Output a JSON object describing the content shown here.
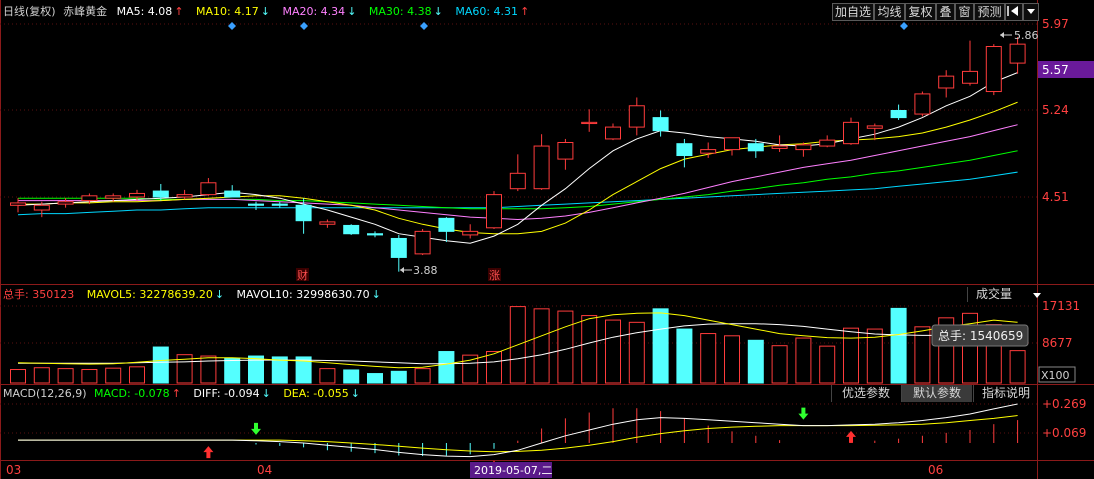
{
  "header": {
    "period": "日线(复权)",
    "stock_name": "赤峰黄金",
    "ma5": "MA5: 4.08",
    "ma10": "MA10: 4.17",
    "ma20": "MA20: 4.34",
    "ma30": "MA30: 4.38",
    "ma60": "MA60: 4.31"
  },
  "toolbar": {
    "add_favorite": "加自选",
    "avg_line": "均线",
    "adjust": "复权",
    "overlay": "叠",
    "window": "窗",
    "forecast": "预测"
  },
  "price_axis": {
    "labels": [
      "5.97",
      "5.57",
      "5.24",
      "4.51"
    ],
    "highlight": "5.57",
    "max_note": "5.86",
    "min_note": "3.88"
  },
  "markers": {
    "cai": "财",
    "zhang": "涨"
  },
  "volume": {
    "total": "总手: 350123",
    "mavol5": "MAVOL5: 32278639.20",
    "mavol10": "MAVOL10: 32998630.70",
    "selector": "成交量",
    "axis_top": "17131",
    "axis_mid": "8677",
    "axis_unit": "X100",
    "tooltip": "总手: 1540659"
  },
  "macd": {
    "title": "MACD(12,26,9)",
    "macd": "MACD: -0.078",
    "diff": "DIFF: -0.094",
    "dea": "DEA: -0.055",
    "btn_optimize": "优选参数",
    "btn_default": "默认参数",
    "btn_explain": "指标说明",
    "axis_top": "+0.269",
    "axis_mid": "+0.069"
  },
  "date_axis": {
    "labels": [
      "03",
      "04",
      "06"
    ],
    "cursor_date": "2019-05-07,二"
  },
  "colors": {
    "up": "#ff3c3c",
    "down": "#54ffff",
    "ma5": "#ffffff",
    "ma10": "#ffff00",
    "ma20": "#ff80ff",
    "ma30": "#00ff00",
    "ma60": "#00d8ff"
  },
  "chart_data": {
    "type": "candlestick",
    "price_ylim": [
      3.88,
      5.97
    ],
    "candles": [
      {
        "o": 4.44,
        "h": 4.5,
        "l": 4.38,
        "c": 4.46
      },
      {
        "o": 4.4,
        "h": 4.47,
        "l": 4.34,
        "c": 4.44
      },
      {
        "o": 4.45,
        "h": 4.5,
        "l": 4.42,
        "c": 4.47
      },
      {
        "o": 4.48,
        "h": 4.54,
        "l": 4.45,
        "c": 4.52
      },
      {
        "o": 4.5,
        "h": 4.54,
        "l": 4.47,
        "c": 4.52
      },
      {
        "o": 4.51,
        "h": 4.57,
        "l": 4.48,
        "c": 4.54
      },
      {
        "o": 4.56,
        "h": 4.62,
        "l": 4.48,
        "c": 4.51
      },
      {
        "o": 4.51,
        "h": 4.57,
        "l": 4.49,
        "c": 4.53
      },
      {
        "o": 4.53,
        "h": 4.67,
        "l": 4.52,
        "c": 4.63
      },
      {
        "o": 4.56,
        "h": 4.61,
        "l": 4.51,
        "c": 4.51
      },
      {
        "o": 4.45,
        "h": 4.47,
        "l": 4.4,
        "c": 4.44
      },
      {
        "o": 4.45,
        "h": 4.47,
        "l": 4.42,
        "c": 4.44
      },
      {
        "o": 4.44,
        "h": 4.5,
        "l": 4.2,
        "c": 4.31
      },
      {
        "o": 4.28,
        "h": 4.32,
        "l": 4.25,
        "c": 4.3
      },
      {
        "o": 4.27,
        "h": 4.28,
        "l": 4.19,
        "c": 4.2
      },
      {
        "o": 4.2,
        "h": 4.22,
        "l": 4.17,
        "c": 4.19
      },
      {
        "o": 4.16,
        "h": 4.19,
        "l": 3.88,
        "c": 4.0
      },
      {
        "o": 4.03,
        "h": 4.24,
        "l": 4.02,
        "c": 4.22
      },
      {
        "o": 4.33,
        "h": 4.34,
        "l": 4.13,
        "c": 4.22
      },
      {
        "o": 4.19,
        "h": 4.28,
        "l": 4.16,
        "c": 4.22
      },
      {
        "o": 4.25,
        "h": 4.56,
        "l": 4.24,
        "c": 4.53
      },
      {
        "o": 4.58,
        "h": 4.87,
        "l": 4.56,
        "c": 4.71
      },
      {
        "o": 4.58,
        "h": 5.04,
        "l": 4.57,
        "c": 4.94
      },
      {
        "o": 4.83,
        "h": 5.0,
        "l": 4.74,
        "c": 4.97
      },
      {
        "o": 5.13,
        "h": 5.25,
        "l": 5.06,
        "c": 5.14
      },
      {
        "o": 5.0,
        "h": 5.13,
        "l": 4.99,
        "c": 5.1
      },
      {
        "o": 5.1,
        "h": 5.35,
        "l": 5.03,
        "c": 5.28
      },
      {
        "o": 5.18,
        "h": 5.24,
        "l": 5.02,
        "c": 5.07
      },
      {
        "o": 4.96,
        "h": 5.0,
        "l": 4.76,
        "c": 4.86
      },
      {
        "o": 4.88,
        "h": 4.97,
        "l": 4.84,
        "c": 4.91
      },
      {
        "o": 4.91,
        "h": 5.01,
        "l": 4.86,
        "c": 5.01
      },
      {
        "o": 4.96,
        "h": 5.0,
        "l": 4.84,
        "c": 4.9
      },
      {
        "o": 4.92,
        "h": 5.03,
        "l": 4.89,
        "c": 4.94
      },
      {
        "o": 4.91,
        "h": 4.97,
        "l": 4.85,
        "c": 4.95
      },
      {
        "o": 4.94,
        "h": 5.03,
        "l": 4.93,
        "c": 4.99
      },
      {
        "o": 4.96,
        "h": 5.18,
        "l": 4.95,
        "c": 5.14
      },
      {
        "o": 5.09,
        "h": 5.13,
        "l": 4.99,
        "c": 5.11
      },
      {
        "o": 5.24,
        "h": 5.29,
        "l": 5.16,
        "c": 5.18
      },
      {
        "o": 5.21,
        "h": 5.4,
        "l": 5.19,
        "c": 5.38
      },
      {
        "o": 5.43,
        "h": 5.58,
        "l": 5.35,
        "c": 5.53
      },
      {
        "o": 5.47,
        "h": 5.83,
        "l": 5.45,
        "c": 5.57
      },
      {
        "o": 5.4,
        "h": 5.8,
        "l": 5.37,
        "c": 5.78
      },
      {
        "o": 5.64,
        "h": 5.86,
        "l": 5.55,
        "c": 5.8
      }
    ],
    "ma5": [
      4.44,
      4.45,
      4.46,
      4.47,
      4.48,
      4.49,
      4.5,
      4.51,
      4.53,
      4.55,
      4.53,
      4.5,
      4.45,
      4.4,
      4.34,
      4.28,
      4.2,
      4.17,
      4.14,
      4.12,
      4.18,
      4.28,
      4.44,
      4.58,
      4.75,
      4.9,
      5.0,
      5.07,
      5.05,
      5.02,
      5.0,
      4.98,
      4.95,
      4.94,
      4.96,
      5.0,
      5.04,
      5.1,
      5.18,
      5.28,
      5.36,
      5.48,
      5.56
    ],
    "ma10": [
      4.45,
      4.45,
      4.46,
      4.46,
      4.47,
      4.47,
      4.48,
      4.49,
      4.5,
      4.51,
      4.52,
      4.52,
      4.5,
      4.47,
      4.44,
      4.4,
      4.33,
      4.28,
      4.24,
      4.21,
      4.2,
      4.2,
      4.22,
      4.29,
      4.4,
      4.53,
      4.64,
      4.75,
      4.83,
      4.87,
      4.91,
      4.93,
      4.95,
      4.96,
      4.98,
      4.99,
      5.0,
      5.02,
      5.05,
      5.1,
      5.16,
      5.23,
      5.31
    ],
    "ma20": [
      4.48,
      4.48,
      4.48,
      4.48,
      4.48,
      4.48,
      4.48,
      4.49,
      4.49,
      4.49,
      4.48,
      4.47,
      4.46,
      4.45,
      4.44,
      4.42,
      4.4,
      4.38,
      4.36,
      4.34,
      4.33,
      4.32,
      4.33,
      4.35,
      4.38,
      4.42,
      4.46,
      4.5,
      4.54,
      4.59,
      4.64,
      4.68,
      4.72,
      4.76,
      4.79,
      4.82,
      4.86,
      4.9,
      4.94,
      4.98,
      5.02,
      5.07,
      5.12
    ],
    "ma30": [
      4.5,
      4.5,
      4.5,
      4.5,
      4.5,
      4.5,
      4.49,
      4.49,
      4.49,
      4.49,
      4.49,
      4.48,
      4.48,
      4.47,
      4.46,
      4.45,
      4.44,
      4.43,
      4.42,
      4.41,
      4.41,
      4.41,
      4.41,
      4.42,
      4.43,
      4.45,
      4.47,
      4.49,
      4.51,
      4.53,
      4.56,
      4.58,
      4.61,
      4.63,
      4.66,
      4.68,
      4.71,
      4.73,
      4.76,
      4.79,
      4.82,
      4.86,
      4.9
    ],
    "ma60": [
      4.36,
      4.37,
      4.37,
      4.38,
      4.39,
      4.4,
      4.4,
      4.41,
      4.42,
      4.42,
      4.42,
      4.42,
      4.42,
      4.42,
      4.42,
      4.42,
      4.42,
      4.42,
      4.42,
      4.42,
      4.42,
      4.43,
      4.44,
      4.45,
      4.46,
      4.47,
      4.48,
      4.49,
      4.5,
      4.51,
      4.52,
      4.53,
      4.54,
      4.55,
      4.56,
      4.57,
      4.58,
      4.6,
      4.62,
      4.64,
      4.66,
      4.69,
      4.72
    ],
    "volume_ylim": [
      0,
      17131
    ],
    "volume": [
      3000,
      3400,
      3200,
      3000,
      3300,
      3600,
      8000,
      6300,
      6000,
      5500,
      6000,
      5800,
      5800,
      3200,
      2900,
      2100,
      2600,
      3200,
      7000,
      6200,
      7000,
      17000,
      16500,
      16000,
      15000,
      14000,
      13500,
      16500,
      12000,
      11000,
      10500,
      9500,
      8300,
      10000,
      8200,
      12200,
      12000,
      16600,
      12500,
      14500,
      15500,
      13000,
      7200
    ],
    "mavol5": [
      4500,
      4400,
      4300,
      4200,
      4300,
      4600,
      5000,
      5300,
      5600,
      5600,
      5400,
      5100,
      4900,
      4500,
      4100,
      3700,
      3400,
      3500,
      4200,
      5100,
      6500,
      8500,
      10500,
      12500,
      14300,
      15200,
      15500,
      15600,
      15000,
      14000,
      13000,
      12000,
      11000,
      10500,
      10100,
      10000,
      10200,
      10800,
      11600,
      12500,
      13200,
      14000,
      13500
    ],
    "mavol10": [
      4400,
      4400,
      4400,
      4400,
      4400,
      4500,
      4600,
      4700,
      4900,
      5000,
      5100,
      5100,
      5100,
      5000,
      4900,
      4700,
      4500,
      4300,
      4300,
      4400,
      4700,
      5400,
      6300,
      7500,
      8900,
      10200,
      11200,
      12000,
      12700,
      13100,
      13200,
      13200,
      13000,
      12600,
      12000,
      11400,
      10900,
      10700,
      10600,
      10600,
      10700,
      10900,
      11100
    ],
    "macd_ylim": [
      -0.12,
      0.32
    ],
    "diff": [
      0.02,
      0.02,
      0.02,
      0.02,
      0.02,
      0.02,
      0.02,
      0.02,
      0.02,
      0.02,
      0.015,
      0.01,
      0.0,
      -0.015,
      -0.03,
      -0.045,
      -0.065,
      -0.08,
      -0.09,
      -0.094,
      -0.08,
      -0.05,
      0.0,
      0.05,
      0.09,
      0.13,
      0.16,
      0.175,
      0.17,
      0.16,
      0.15,
      0.14,
      0.13,
      0.12,
      0.12,
      0.125,
      0.13,
      0.14,
      0.155,
      0.175,
      0.2,
      0.235,
      0.269
    ],
    "dea": [
      0.02,
      0.02,
      0.02,
      0.02,
      0.02,
      0.02,
      0.02,
      0.02,
      0.02,
      0.02,
      0.02,
      0.02,
      0.015,
      0.01,
      0.0,
      -0.01,
      -0.022,
      -0.035,
      -0.046,
      -0.055,
      -0.06,
      -0.058,
      -0.05,
      -0.035,
      -0.015,
      0.01,
      0.04,
      0.065,
      0.085,
      0.1,
      0.11,
      0.115,
      0.12,
      0.12,
      0.12,
      0.12,
      0.122,
      0.125,
      0.13,
      0.14,
      0.155,
      0.17,
      0.19
    ],
    "signal_up": [
      8,
      20,
      35
    ],
    "signal_down": [
      10,
      33
    ]
  }
}
